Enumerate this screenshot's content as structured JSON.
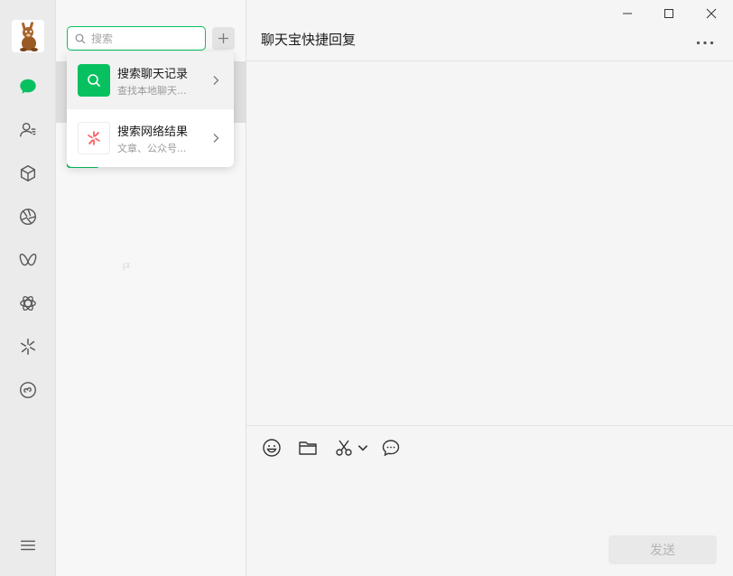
{
  "search": {
    "value": "",
    "placeholder": "搜索"
  },
  "dropdown": {
    "items": [
      {
        "title": "搜索聊天记录",
        "subtitle": "查找本地聊天..."
      },
      {
        "title": "搜索网络结果",
        "subtitle": "文章、公众号..."
      }
    ]
  },
  "chat": {
    "title": "聊天宝快捷回复",
    "send_label": "发送"
  },
  "colors": {
    "accent": "#07c160",
    "search_web_icon": "#fa5151"
  },
  "icons": {
    "rail": [
      "chat-icon",
      "contacts-icon",
      "favorites-icon",
      "moments-icon",
      "channels-icon",
      "search-network-icon",
      "discover-icon",
      "mini-programs-icon",
      "menu-icon"
    ],
    "toolbar": [
      "emoji-icon",
      "folder-icon",
      "scissors-icon",
      "chevron-down-icon",
      "chat-history-icon"
    ]
  }
}
